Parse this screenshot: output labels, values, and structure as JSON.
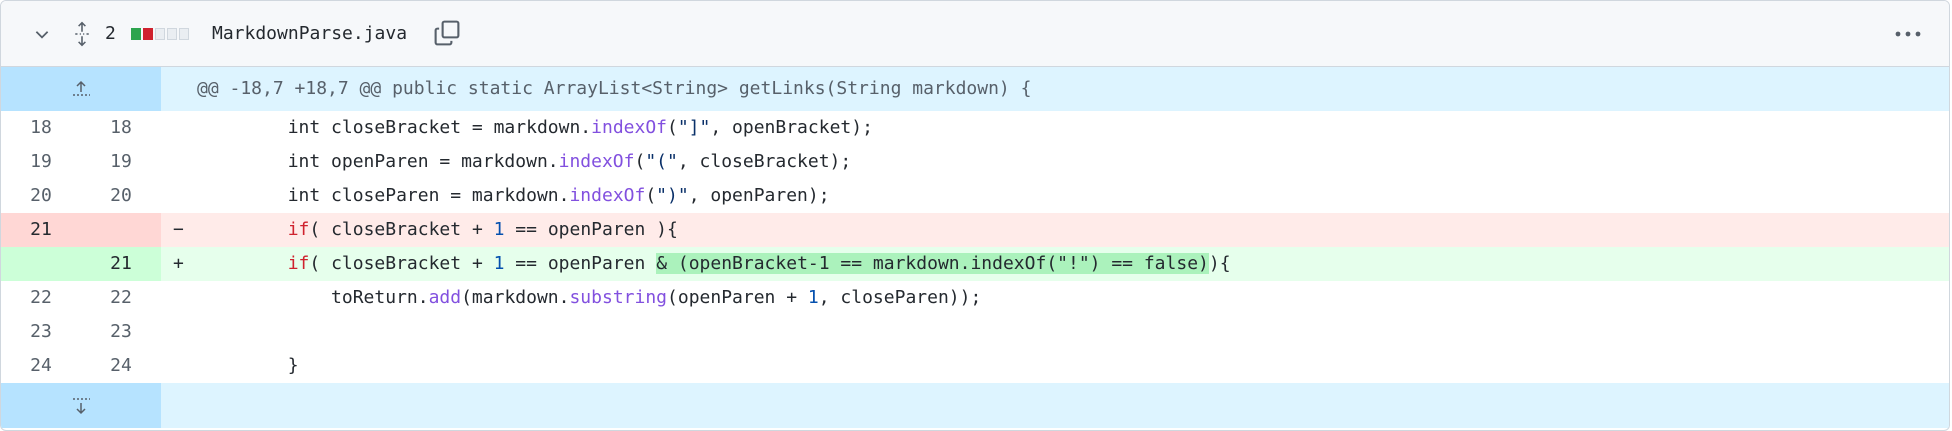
{
  "header": {
    "changes_count": "2",
    "file_name": "MarkdownParse.java",
    "diffstat": [
      "add",
      "del",
      "neu",
      "neu",
      "neu"
    ]
  },
  "hunk": {
    "text": "@@ -18,7 +18,7 @@ public static ArrayList<String> getLinks(String markdown) {"
  },
  "lines": [
    {
      "type": "ctx",
      "old": "18",
      "new": "18",
      "mark": "",
      "segs": [
        [
          "",
          "        int closeBracket = markdown."
        ],
        [
          "fn",
          "indexOf"
        ],
        [
          "",
          "("
        ],
        [
          "str",
          "\"]\""
        ],
        [
          "",
          ", openBracket);"
        ]
      ]
    },
    {
      "type": "ctx",
      "old": "19",
      "new": "19",
      "mark": "",
      "segs": [
        [
          "",
          "        int openParen = markdown."
        ],
        [
          "fn",
          "indexOf"
        ],
        [
          "",
          "("
        ],
        [
          "str",
          "\"(\""
        ],
        [
          "",
          ", closeBracket);"
        ]
      ]
    },
    {
      "type": "ctx",
      "old": "20",
      "new": "20",
      "mark": "",
      "segs": [
        [
          "",
          "        int closeParen = markdown."
        ],
        [
          "fn",
          "indexOf"
        ],
        [
          "",
          "("
        ],
        [
          "str",
          "\")\""
        ],
        [
          "",
          ", openParen);"
        ]
      ]
    },
    {
      "type": "del",
      "old": "21",
      "new": "",
      "mark": "−",
      "segs": [
        [
          "",
          "        "
        ],
        [
          "kw",
          "if"
        ],
        [
          "",
          "( closeBracket + "
        ],
        [
          "num",
          "1"
        ],
        [
          "",
          " == openParen ){"
        ]
      ]
    },
    {
      "type": "add",
      "old": "",
      "new": "21",
      "mark": "+",
      "segs": [
        [
          "",
          "        "
        ],
        [
          "kw",
          "if"
        ],
        [
          "",
          "( closeBracket + "
        ],
        [
          "num",
          "1"
        ],
        [
          "",
          " == openParen "
        ],
        [
          "hl",
          "& (openBracket-1 == markdown.indexOf(\"!\") == false)"
        ],
        [
          "",
          "){"
        ]
      ]
    },
    {
      "type": "ctx",
      "old": "22",
      "new": "22",
      "mark": "",
      "segs": [
        [
          "",
          "            toReturn."
        ],
        [
          "fn",
          "add"
        ],
        [
          "",
          "(markdown."
        ],
        [
          "fn",
          "substring"
        ],
        [
          "",
          "(openParen + "
        ],
        [
          "num",
          "1"
        ],
        [
          "",
          ", closeParen));"
        ]
      ]
    },
    {
      "type": "ctx",
      "old": "23",
      "new": "23",
      "mark": "",
      "segs": [
        [
          "",
          ""
        ]
      ]
    },
    {
      "type": "ctx",
      "old": "24",
      "new": "24",
      "mark": "",
      "segs": [
        [
          "",
          "        }"
        ]
      ]
    }
  ],
  "icons": {
    "collapse": "chevron-down-icon",
    "expand_all": "unfold-icon",
    "copy": "copy-icon",
    "more": "kebab-horizontal-icon",
    "expand_up": "fold-up-icon",
    "expand_down": "fold-down-icon"
  },
  "colors": {
    "hunk_bg": "#ddf4ff",
    "hunk_gutter": "#b6e3ff",
    "del_bg": "#ffebe9",
    "add_bg": "#e6ffec",
    "add_highlight": "#abf2bc"
  }
}
